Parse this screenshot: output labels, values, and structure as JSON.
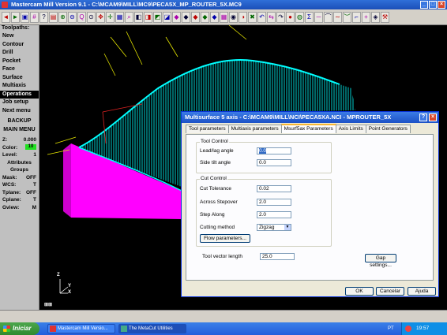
{
  "app": {
    "title": "Mastercam Mill Version 9.1 - C:\\MCAM9\\MILL\\MC9\\PECA5X_MP_ROUTER_5X.MC9",
    "min": "_",
    "max": "□",
    "close": "×"
  },
  "toolbar": {
    "icons": [
      "arrow-left-icon",
      "arrow-right-icon",
      "screen-icon",
      "hash-icon",
      "question-icon",
      "box-icon",
      "zoom-in-icon",
      "zoom-out-icon",
      "zoom-icon",
      "zoom-fit-icon",
      "pan-icon",
      "move-icon",
      "sheet-icon",
      "select-icon",
      "view-top-icon",
      "view-front-icon",
      "view-side-icon",
      "view-iso-icon",
      "cube-icon",
      "cube-icon",
      "cube-icon",
      "cube-icon",
      "cube-icon",
      "grid-icon",
      "color-icon",
      "shade-icon",
      "delete-icon",
      "undo-icon",
      "swap-icon",
      "redo-icon",
      "sphere-icon",
      "wireframe-icon",
      "sigma-icon",
      "line-icon",
      "arc-icon",
      "spline-icon",
      "curve-icon",
      "chamfer-icon",
      "plus-icon",
      "tag-icon",
      "tool-icon"
    ],
    "glyphs": [
      "◄",
      "►",
      "▣",
      "#",
      "?",
      "▤",
      "⊕",
      "⊖",
      "Q",
      "⊙",
      "✥",
      "✛",
      "▦",
      "⌕",
      "◧",
      "◨",
      "◩",
      "◪",
      "◆",
      "◆",
      "◆",
      "◆",
      "◆",
      "▦",
      "◉",
      "◑",
      "✖",
      "↶",
      "⇆",
      "↷",
      "●",
      "◍",
      "Σ",
      "─",
      "⌒",
      "∼",
      "︶",
      "⌐",
      "+",
      "◈",
      "⚒"
    ]
  },
  "menu": {
    "header": "Toolpaths:",
    "items": [
      "New",
      "Contour",
      "Drill",
      "Pocket",
      "Face",
      "Surface",
      "Multiaxis",
      "Operations",
      "Job setup",
      "Next menu"
    ],
    "selected_index": 7,
    "backup": "BACKUP",
    "main_menu": "MAIN MENU",
    "status": [
      {
        "key": "Z:",
        "value": "0.000"
      },
      {
        "key": "Color:",
        "value": "10"
      },
      {
        "key": "Level:",
        "value": "1"
      },
      {
        "key": "Attributes",
        "value": ""
      },
      {
        "key": "Groups",
        "value": ""
      },
      {
        "key": "Mask:",
        "value": "OFF"
      },
      {
        "key": "WCS:",
        "value": "T"
      },
      {
        "key": "Tplane:",
        "value": "OFF"
      },
      {
        "key": "Cplane:",
        "value": "T"
      },
      {
        "key": "Gview:",
        "value": "M"
      }
    ]
  },
  "viewport": {
    "axis_labels": {
      "z": "Z",
      "y": "Y",
      "x": "X"
    },
    "corner_label": "⊞⊞",
    "colors": {
      "cyan": "#00e5e5",
      "magenta": "#ff00ff",
      "yellow": "#e5e500"
    }
  },
  "dialog": {
    "title": "Multisurface 5 axis - C:\\MCAM9\\MILL\\NCI\\PECA5XA.NCI - MPROUTER_5X",
    "help": "?",
    "close": "×",
    "tabs": [
      "Tool parameters",
      "Multiaxis parameters",
      "Msurf5ax Parameters",
      "Axis Limits",
      "Point Generators"
    ],
    "active_tab": 2,
    "tool_control": {
      "label": "Tool Control",
      "lead_lag_label": "Lead/lag angle",
      "lead_lag_value": "0.0",
      "side_tilt_label": "Side tilt angle",
      "side_tilt_value": "0.0"
    },
    "cut_control": {
      "label": "Cut Control",
      "cut_tol_label": "Cut Tolerance",
      "cut_tol_value": "0.02",
      "across_label": "Across Stepover",
      "across_value": "2.0",
      "step_along_label": "Step Along",
      "step_along_value": "2.0",
      "method_label": "Cutting method",
      "method_value": "Zigzag",
      "flow_button": "Flow parameters..."
    },
    "tool_vector_label": "Tool vector length",
    "tool_vector_value": "25.0",
    "gap_button": "Gap settings...",
    "ok": "OK",
    "cancel": "Cancelar",
    "help_button": "Ajuda"
  },
  "taskbar": {
    "start": "Iniciar",
    "tasks": [
      "Mastercam Mill Versio...",
      "The MetaCut Utilities"
    ],
    "lang": "PT",
    "clock": "19:57"
  }
}
